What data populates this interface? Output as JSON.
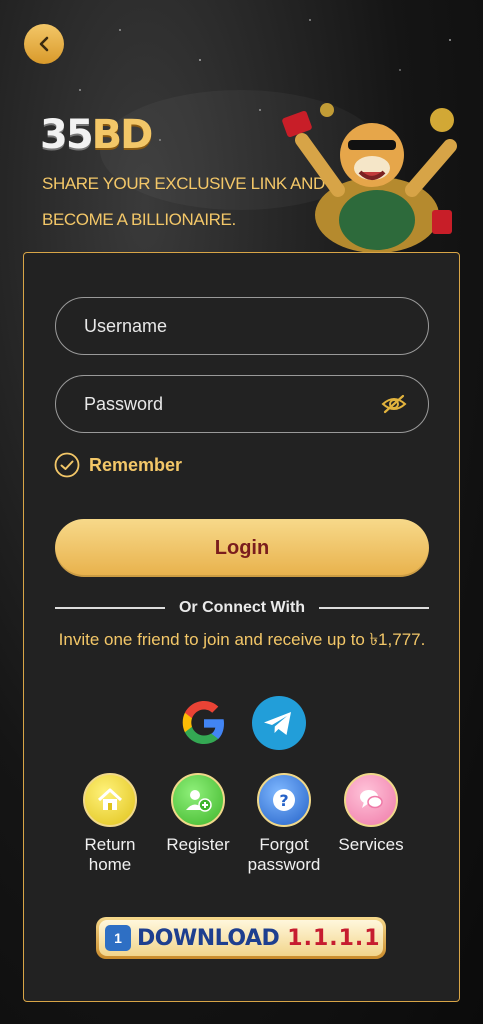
{
  "brand": {
    "logo_main": "35",
    "logo_accent": "BD",
    "tagline_line1": "SHARE YOUR EXCLUSIVE LINK AND",
    "tagline_line2": "BECOME A BILLIONAIRE."
  },
  "form": {
    "username_placeholder": "Username",
    "password_placeholder": "Password",
    "remember_label": "Remember",
    "login_label": "Login"
  },
  "connect": {
    "divider_label": "Or Connect With",
    "invite_text": "Invite one friend to join and receive up to ৳1,777."
  },
  "quick_links": [
    {
      "label": "Return home",
      "icon": "home-icon"
    },
    {
      "label": "Register",
      "icon": "add-user-icon"
    },
    {
      "label": "Forgot password",
      "icon": "question-icon"
    },
    {
      "label": "Services",
      "icon": "chat-icon"
    }
  ],
  "download": {
    "word": "DOWNLOAD",
    "version": "1.1.1.1"
  },
  "colors": {
    "accent_gold": "#f3c768",
    "panel_bg": "#222222",
    "login_text": "#7a1d1d"
  }
}
